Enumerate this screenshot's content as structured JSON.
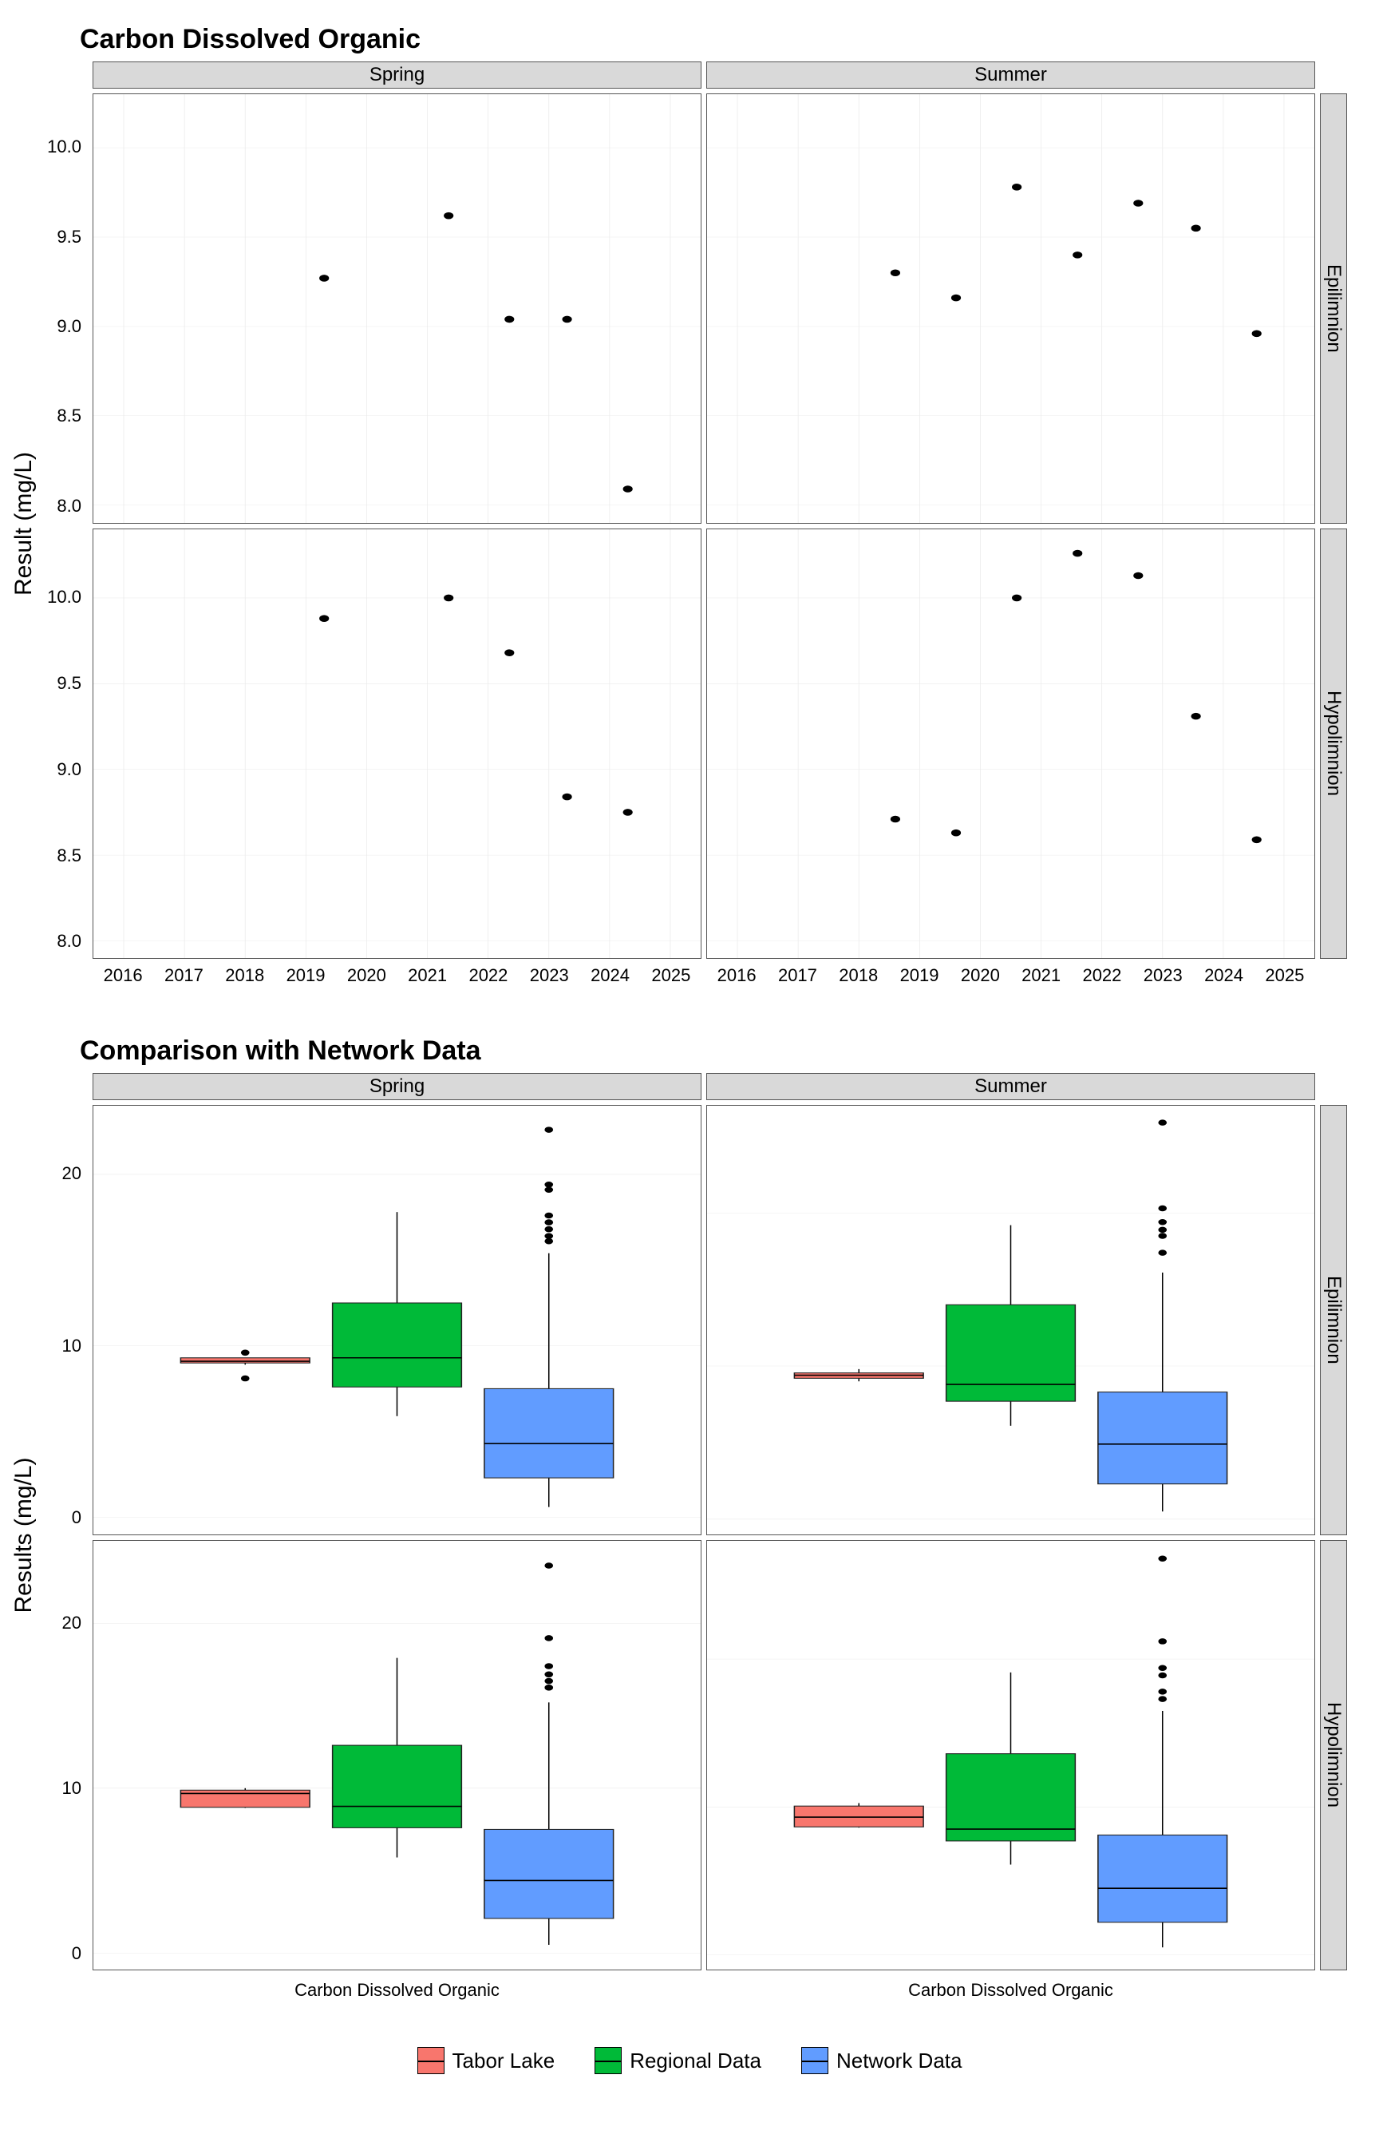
{
  "chart_data": [
    {
      "type": "scatter",
      "title": "Carbon Dissolved Organic",
      "ylabel": "Result (mg/L)",
      "facets_col": [
        "Spring",
        "Summer"
      ],
      "facets_row": [
        "Epilimnion",
        "Hypolimnion"
      ],
      "x_ticks": [
        2016,
        2017,
        2018,
        2019,
        2020,
        2021,
        2022,
        2023,
        2024,
        2025
      ],
      "xr": [
        2015.5,
        2025.5
      ],
      "panels": [
        {
          "col": "Spring",
          "row": "Epilimnion",
          "ylim": [
            7.9,
            10.3
          ],
          "y_ticks": [
            8.0,
            8.5,
            9.0,
            9.5,
            10.0
          ],
          "points": [
            {
              "x": 2019.3,
              "y": 9.27
            },
            {
              "x": 2021.35,
              "y": 9.62
            },
            {
              "x": 2022.35,
              "y": 9.04
            },
            {
              "x": 2023.3,
              "y": 9.04
            },
            {
              "x": 2024.3,
              "y": 8.09
            }
          ]
        },
        {
          "col": "Summer",
          "row": "Epilimnion",
          "ylim": [
            7.9,
            10.3
          ],
          "y_ticks": [
            8.0,
            8.5,
            9.0,
            9.5,
            10.0
          ],
          "points": [
            {
              "x": 2018.6,
              "y": 9.3
            },
            {
              "x": 2019.6,
              "y": 9.16
            },
            {
              "x": 2020.6,
              "y": 9.78
            },
            {
              "x": 2021.6,
              "y": 9.4
            },
            {
              "x": 2022.6,
              "y": 9.69
            },
            {
              "x": 2023.55,
              "y": 9.55
            },
            {
              "x": 2024.55,
              "y": 8.96
            }
          ]
        },
        {
          "col": "Spring",
          "row": "Hypolimnion",
          "ylim": [
            7.9,
            10.4
          ],
          "y_ticks": [
            8.0,
            8.5,
            9.0,
            9.5,
            10.0
          ],
          "points": [
            {
              "x": 2019.3,
              "y": 9.88
            },
            {
              "x": 2021.35,
              "y": 10.0
            },
            {
              "x": 2022.35,
              "y": 9.68
            },
            {
              "x": 2023.3,
              "y": 8.84
            },
            {
              "x": 2024.3,
              "y": 8.75
            }
          ]
        },
        {
          "col": "Summer",
          "row": "Hypolimnion",
          "ylim": [
            7.9,
            10.4
          ],
          "y_ticks": [
            8.0,
            8.5,
            9.0,
            9.5,
            10.0
          ],
          "points": [
            {
              "x": 2018.6,
              "y": 8.71
            },
            {
              "x": 2019.6,
              "y": 8.63
            },
            {
              "x": 2020.6,
              "y": 10.0
            },
            {
              "x": 2021.6,
              "y": 10.26
            },
            {
              "x": 2022.6,
              "y": 10.13
            },
            {
              "x": 2023.55,
              "y": 9.31
            },
            {
              "x": 2024.55,
              "y": 8.59
            }
          ]
        }
      ]
    },
    {
      "type": "box",
      "title": "Comparison with Network Data",
      "ylabel": "Results (mg/L)",
      "xlabel_each": "Carbon Dissolved Organic",
      "facets_col": [
        "Spring",
        "Summer"
      ],
      "facets_row": [
        "Epilimnion",
        "Hypolimnion"
      ],
      "series": [
        {
          "name": "Tabor Lake",
          "color": "#f8766d"
        },
        {
          "name": "Regional Data",
          "color": "#00ba38"
        },
        {
          "name": "Network Data",
          "color": "#619cff"
        }
      ],
      "panels": [
        {
          "col": "Spring",
          "row": "Epilimnion",
          "ylim": [
            -1,
            24
          ],
          "y_ticks": [
            0,
            10,
            20
          ],
          "boxes": [
            {
              "series": 0,
              "min": 8.9,
              "q1": 9.0,
              "med": 9.1,
              "q3": 9.3,
              "max": 9.3,
              "outliers": [
                8.1,
                9.6
              ]
            },
            {
              "series": 1,
              "min": 5.9,
              "q1": 7.6,
              "med": 9.3,
              "q3": 12.5,
              "max": 17.8,
              "outliers": []
            },
            {
              "series": 2,
              "min": 0.6,
              "q1": 2.3,
              "med": 4.3,
              "q3": 7.5,
              "max": 15.4,
              "outliers": [
                16.1,
                16.4,
                16.8,
                17.2,
                17.6,
                19.1,
                19.4,
                22.6
              ]
            }
          ]
        },
        {
          "col": "Summer",
          "row": "Epilimnion",
          "ylim": [
            -1,
            27
          ],
          "y_ticks": [
            0,
            10,
            20
          ],
          "boxes": [
            {
              "series": 0,
              "min": 9.0,
              "q1": 9.2,
              "med": 9.4,
              "q3": 9.55,
              "max": 9.8,
              "outliers": []
            },
            {
              "series": 1,
              "min": 6.1,
              "q1": 7.7,
              "med": 8.8,
              "q3": 14.0,
              "max": 19.2,
              "outliers": []
            },
            {
              "series": 2,
              "min": 0.5,
              "q1": 2.3,
              "med": 4.9,
              "q3": 8.3,
              "max": 16.1,
              "outliers": [
                17.4,
                18.5,
                18.9,
                19.4,
                20.3,
                25.9
              ]
            }
          ]
        },
        {
          "col": "Spring",
          "row": "Hypolimnion",
          "ylim": [
            -1,
            25
          ],
          "y_ticks": [
            0,
            10,
            20
          ],
          "boxes": [
            {
              "series": 0,
              "min": 8.8,
              "q1": 8.84,
              "med": 9.68,
              "q3": 9.88,
              "max": 10.0,
              "outliers": []
            },
            {
              "series": 1,
              "min": 5.8,
              "q1": 7.6,
              "med": 8.9,
              "q3": 12.6,
              "max": 17.9,
              "outliers": []
            },
            {
              "series": 2,
              "min": 0.5,
              "q1": 2.1,
              "med": 4.4,
              "q3": 7.5,
              "max": 15.2,
              "outliers": [
                16.1,
                16.5,
                16.9,
                17.4,
                19.1,
                23.5
              ]
            }
          ]
        },
        {
          "col": "Summer",
          "row": "Hypolimnion",
          "ylim": [
            -1,
            28
          ],
          "y_ticks": [
            0,
            10,
            20
          ],
          "boxes": [
            {
              "series": 0,
              "min": 8.6,
              "q1": 8.65,
              "med": 9.31,
              "q3": 10.06,
              "max": 10.26,
              "outliers": []
            },
            {
              "series": 1,
              "min": 6.1,
              "q1": 7.7,
              "med": 8.5,
              "q3": 13.6,
              "max": 19.1,
              "outliers": []
            },
            {
              "series": 2,
              "min": 0.5,
              "q1": 2.2,
              "med": 4.5,
              "q3": 8.1,
              "max": 16.5,
              "outliers": [
                17.3,
                17.8,
                18.9,
                19.4,
                21.2,
                26.8
              ]
            }
          ]
        }
      ]
    }
  ],
  "legend": {
    "items": [
      {
        "label": "Tabor Lake",
        "color": "#f8766d"
      },
      {
        "label": "Regional Data",
        "color": "#00ba38"
      },
      {
        "label": "Network Data",
        "color": "#619cff"
      }
    ]
  }
}
